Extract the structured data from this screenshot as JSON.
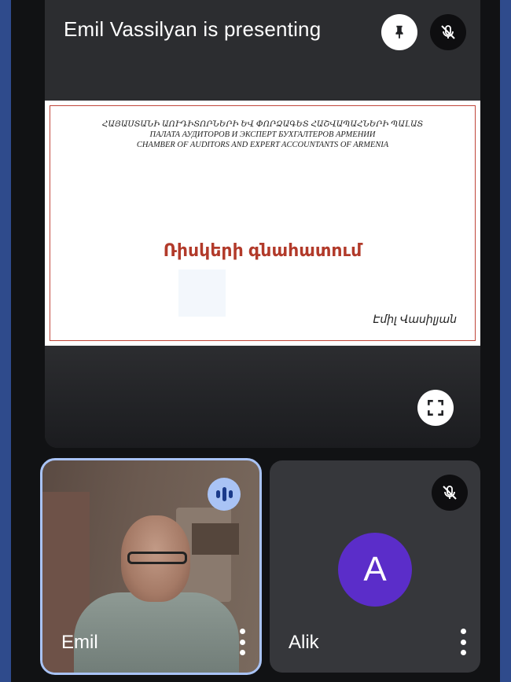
{
  "presentation": {
    "title": "Emil Vassilyan is presenting",
    "slide": {
      "line1": "ՀԱՅԱՍՏԱՆԻ ԱՈՒԴԻՏՈՐՆԵՐԻ ԵՎ ՓՈՐՁԱԳԵՏ ՀԱՇՎԱՊԱՀՆԵՐԻ ՊԱԼԱՏ",
      "line2": "ПАЛАТА АУДИТОРОВ И ЭКСПЕРТ БУХГАЛТЕРОВ АРМЕНИИ",
      "line3": "CHAMBER OF AUDITORS AND EXPERT ACCOUNTANTS OF ARMENIA",
      "title": "Ռիսկերի գնահատում",
      "author": "Էմիլ Վասիլյան"
    },
    "icons": {
      "pin": "pin-icon",
      "mic": "mic-off-icon",
      "fullscreen": "fullscreen-icon"
    }
  },
  "participants": [
    {
      "name": "Emil",
      "speaking": true
    },
    {
      "name": "Alik",
      "avatar_letter": "A",
      "muted": true
    }
  ],
  "colors": {
    "background": "#111214",
    "tile": "#2c2d30",
    "active_outline": "#a9c3f5",
    "avatar": "#5b2dc9",
    "slide_title": "#b23a2a"
  }
}
